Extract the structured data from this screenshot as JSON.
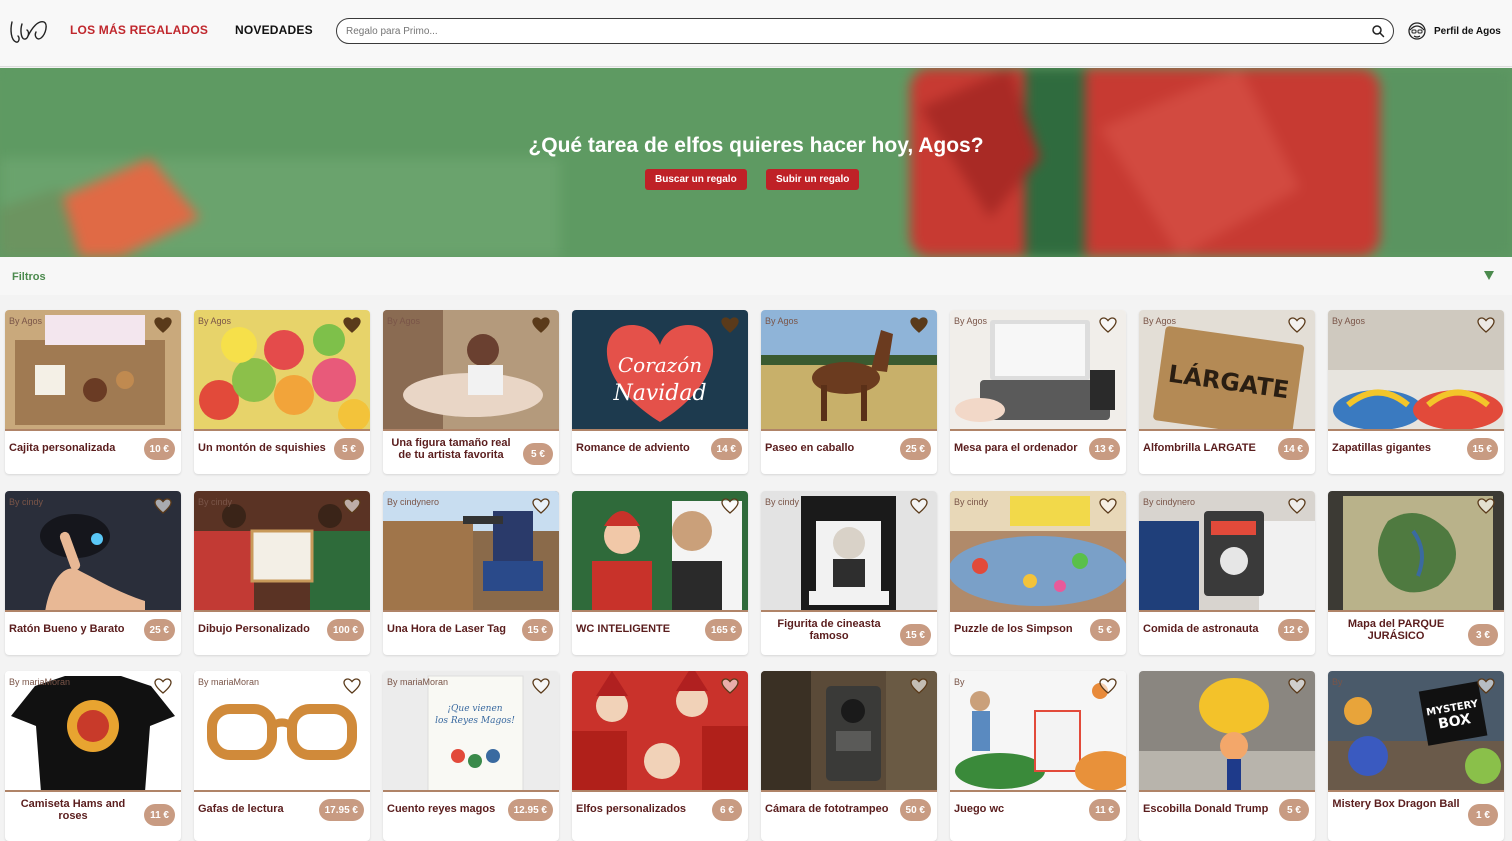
{
  "header": {
    "nav": [
      {
        "label": "LOS MÁS REGALADOS"
      },
      {
        "label": "NOVEDADES"
      }
    ],
    "search_placeholder": "Regalo para Primo...",
    "profile_label": "Perfil de Agos",
    "colors": {
      "accent": "#c0272d"
    }
  },
  "hero": {
    "title": "¿Qué tarea de elfos quieres hacer hoy, Agos?",
    "btn_search": "Buscar un regalo",
    "btn_upload": "Subir un regalo"
  },
  "filters": {
    "label": "Filtros"
  },
  "cards": [
    {
      "author": "By Agos",
      "name": "Cajita personalizada",
      "price": "10 €",
      "favorited": true,
      "img": "gift-box"
    },
    {
      "author": "By Agos",
      "name": "Un montón de squishies",
      "price": "5 €",
      "favorited": true,
      "img": "squishies"
    },
    {
      "author": "By Agos",
      "name": "Una figura tamaño real de tu artista favorita",
      "price": "5 €",
      "favorited": true,
      "img": "artist"
    },
    {
      "author": "",
      "name": "Romance de adviento",
      "price": "14 €",
      "favorited": true,
      "img": "book-heart"
    },
    {
      "author": "By Agos",
      "name": "Paseo en caballo",
      "price": "25 €",
      "favorited": true,
      "img": "horse"
    },
    {
      "author": "By Agos",
      "name": "Mesa para el ordenador",
      "price": "13 €",
      "favorited": false,
      "img": "laptop"
    },
    {
      "author": "By Agos",
      "name": "Alfombrilla LARGATE",
      "price": "14 €",
      "favorited": false,
      "img": "doormat"
    },
    {
      "author": "By Agos",
      "name": "Zapatillas gigantes",
      "price": "15 €",
      "favorited": false,
      "img": "sneakers"
    },
    {
      "author": "By cindy",
      "name": "Ratón Bueno y Barato",
      "price": "25 €",
      "favorited": false,
      "img": "mouse"
    },
    {
      "author": "By cindy",
      "name": "Dibujo Personalizado",
      "price": "100 €",
      "favorited": false,
      "img": "drawing"
    },
    {
      "author": "By cindynero",
      "name": "Una Hora de Laser Tag",
      "price": "15 €",
      "favorited": false,
      "img": "laser"
    },
    {
      "author": "",
      "name": "WC INTELIGENTE",
      "price": "165 €",
      "favorited": false,
      "img": "wc-people"
    },
    {
      "author": "By cindy",
      "name": "Figurita de cineasta famoso",
      "price": "15 €",
      "favorited": false,
      "img": "funko"
    },
    {
      "author": "By cindy",
      "name": "Puzzle de los Simpson",
      "price": "5 €",
      "favorited": false,
      "img": "puzzle"
    },
    {
      "author": "By cindynero",
      "name": "Comida de astronauta",
      "price": "12 €",
      "favorited": false,
      "img": "astronaut"
    },
    {
      "author": "",
      "name": "Mapa del PARQUE JURÁSICO",
      "price": "3 €",
      "favorited": false,
      "img": "map"
    },
    {
      "author": "By mariaMoran",
      "name": "Camiseta Hams and roses",
      "price": "11 €",
      "favorited": false,
      "img": "tshirt"
    },
    {
      "author": "By mariaMoran",
      "name": "Gafas de lectura",
      "price": "17.95 €",
      "favorited": false,
      "img": "glasses"
    },
    {
      "author": "By mariaMoran",
      "name": "Cuento reyes magos",
      "price": "12.95 €",
      "favorited": false,
      "img": "storybook"
    },
    {
      "author": "",
      "name": "Elfos personalizados",
      "price": "6 €",
      "favorited": false,
      "img": "elves"
    },
    {
      "author": "",
      "name": "Cámara de fototrampeo",
      "price": "50 €",
      "favorited": false,
      "img": "trailcam"
    },
    {
      "author": "By",
      "name": "Juego wc",
      "price": "11 €",
      "favorited": false,
      "img": "golf"
    },
    {
      "author": "",
      "name": "Escobilla Donald Trump",
      "price": "5 €",
      "favorited": false,
      "img": "brush"
    },
    {
      "author": "By",
      "name": "Mistery Box Dragon Ball",
      "price": "1 €",
      "favorited": false,
      "img": "mystery"
    }
  ]
}
